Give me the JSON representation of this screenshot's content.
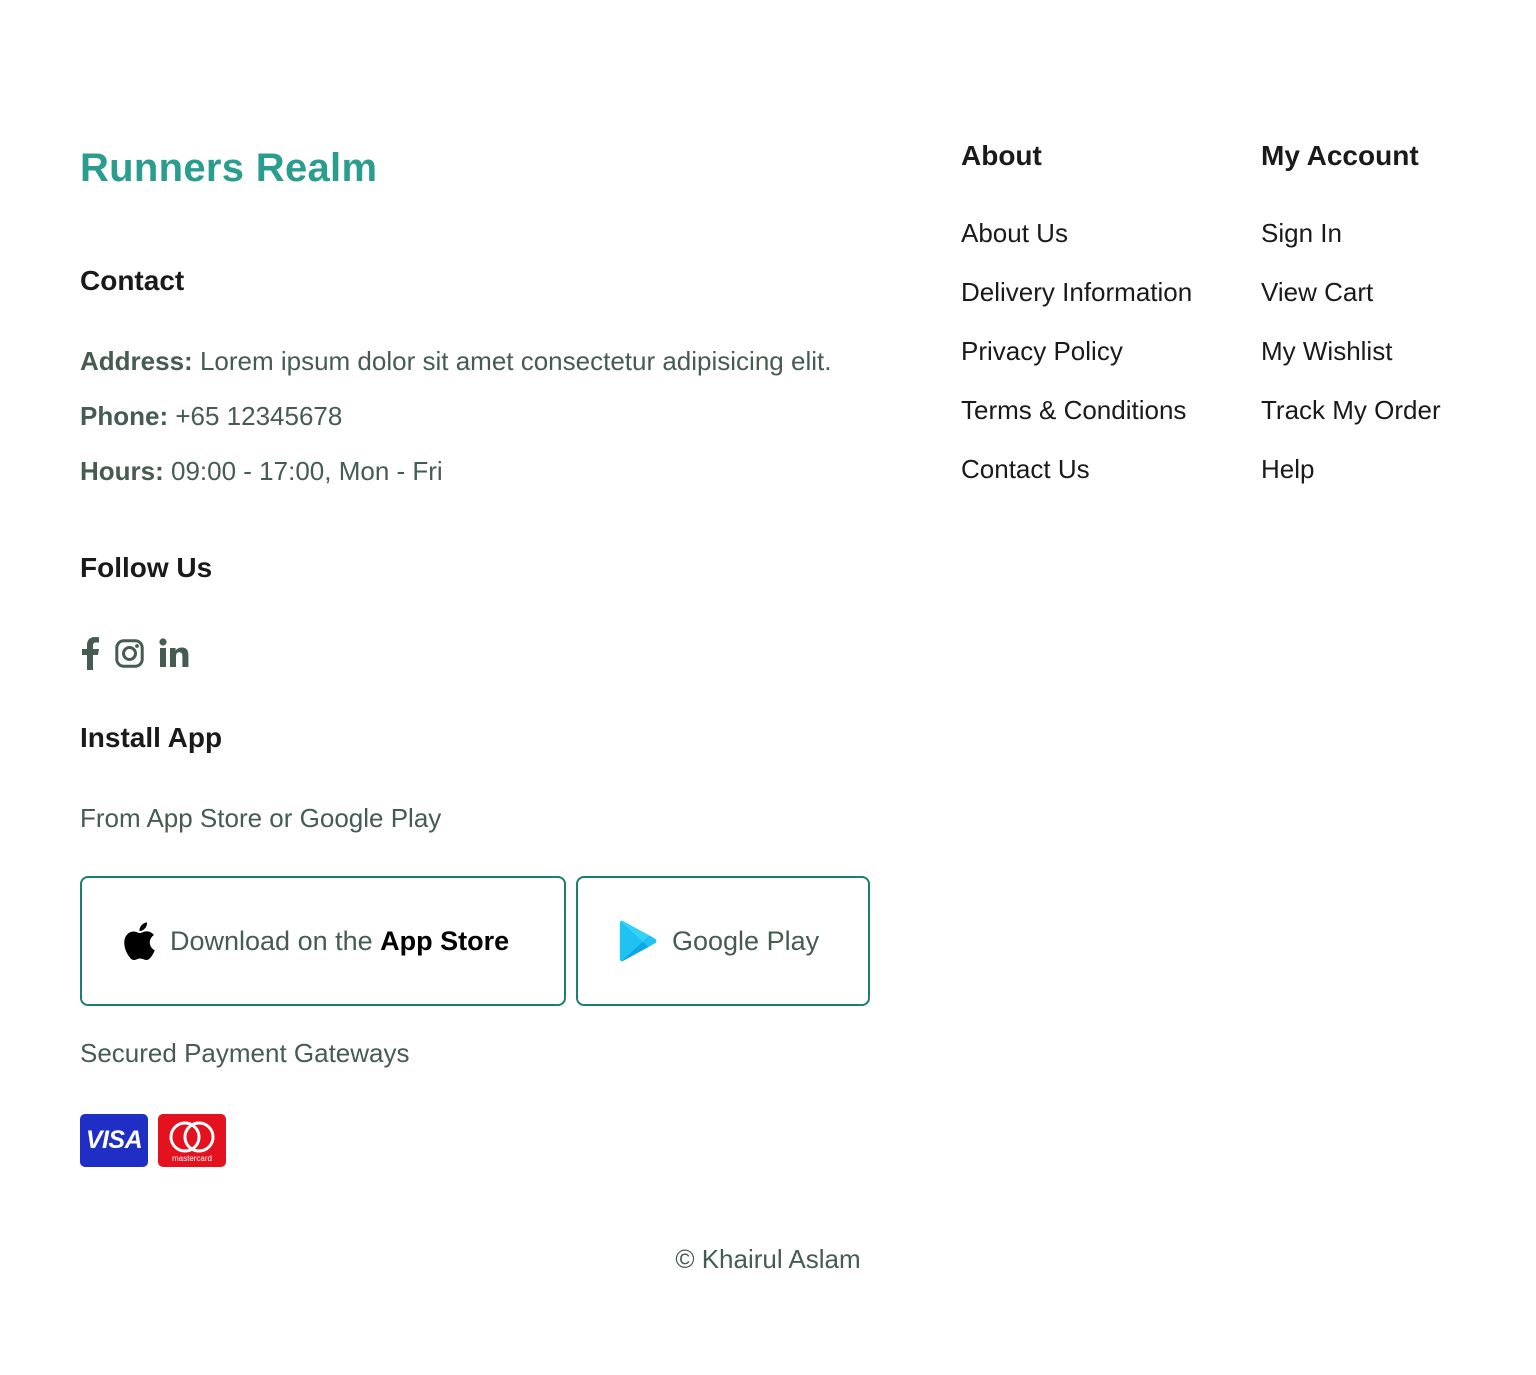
{
  "brand": {
    "name": "Runners Realm",
    "color": "#2a9d8f"
  },
  "contact": {
    "heading": "Contact",
    "address_label": "Address:",
    "address_value": "Lorem ipsum dolor sit amet consectetur adipisicing elit.",
    "phone_label": "Phone:",
    "phone_value": "+65 12345678",
    "hours_label": "Hours:",
    "hours_value": "09:00 - 17:00, Mon - Fri"
  },
  "follow": {
    "heading": "Follow Us",
    "icons": [
      "facebook-icon",
      "instagram-icon",
      "linkedin-icon"
    ]
  },
  "install": {
    "heading": "Install App",
    "subtitle": "From App Store or Google Play",
    "app_store_prefix": "Download on the",
    "app_store_name": "App Store",
    "google_play": "Google Play"
  },
  "payment": {
    "label": "Secured Payment Gateways",
    "visa": "VISA",
    "mastercard": "mastercard"
  },
  "about": {
    "title": "About",
    "links": [
      "About Us",
      "Delivery Information",
      "Privacy Policy",
      "Terms & Conditions",
      "Contact Us"
    ]
  },
  "account": {
    "title": "My Account",
    "links": [
      "Sign In",
      "View Cart",
      "My Wishlist",
      "Track My Order",
      "Help"
    ]
  },
  "copyright": "© Khairul Aslam",
  "colors": {
    "text_muted": "#465b52",
    "heading": "#1a1a1a",
    "button_border": "#1d7e6e"
  }
}
